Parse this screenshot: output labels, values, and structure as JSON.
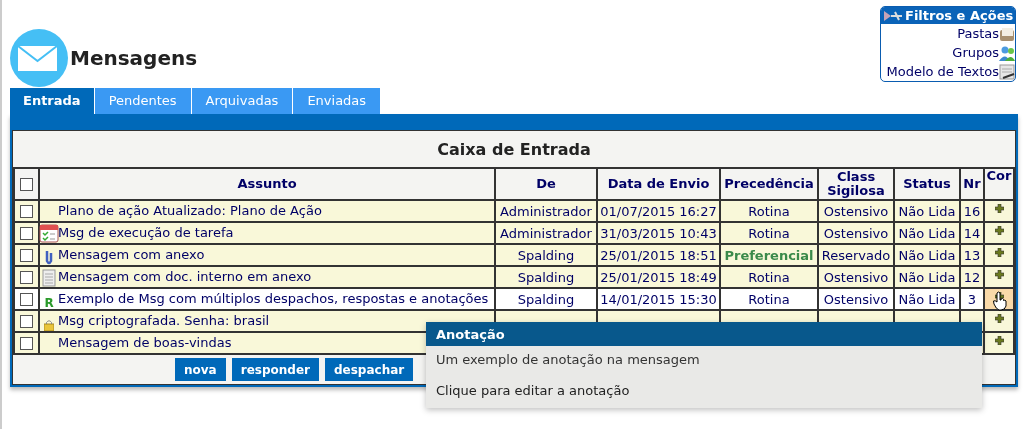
{
  "header": {
    "title": "Mensagens"
  },
  "filters": {
    "title": "Filtros e Ações",
    "links": [
      {
        "label": "Pastas",
        "kind": "folder"
      },
      {
        "label": "Grupos",
        "kind": "people"
      },
      {
        "label": "Modelo de Textos",
        "kind": "template"
      }
    ]
  },
  "tabs": [
    {
      "label": "Entrada",
      "selected": true
    },
    {
      "label": "Pendentes",
      "selected": false
    },
    {
      "label": "Arquivadas",
      "selected": false
    },
    {
      "label": "Enviadas",
      "selected": false
    }
  ],
  "inbox": {
    "title": "Caixa de Entrada",
    "select_all": {
      "checked": false
    },
    "columns": [
      "Assunto",
      "De",
      "Data de Envio",
      "Precedência",
      "Class Sigilosa",
      "Status",
      "Nr",
      "Cor"
    ],
    "rows": [
      {
        "checked": false,
        "highlighted": false,
        "kind": "plain",
        "subject": "Plano de ação Atualizado: Plano de Ação",
        "from": "Administrador",
        "date": "01/07/2015 16:27",
        "precedence": "Rotina",
        "preferential": false,
        "classification": "Ostensivo",
        "status": "Não Lida",
        "nr": "16"
      },
      {
        "checked": false,
        "highlighted": false,
        "kind": "task",
        "subject": "Msg de execução de tarefa",
        "from": "Administrador",
        "date": "31/03/2015 10:43",
        "precedence": "Rotina",
        "preferential": false,
        "classification": "Ostensivo",
        "status": "Não Lida",
        "nr": "14"
      },
      {
        "checked": false,
        "highlighted": false,
        "kind": "attachment",
        "subject": "Mensagem com anexo",
        "from": "Spalding",
        "date": "25/01/2015 18:51",
        "precedence": "Preferencial",
        "preferential": true,
        "classification": "Reservado",
        "status": "Não Lida",
        "nr": "13"
      },
      {
        "checked": false,
        "highlighted": false,
        "kind": "document",
        "subject": "Mensagem com doc. interno em anexo",
        "from": "Spalding",
        "date": "25/01/2015 18:49",
        "precedence": "Rotina",
        "preferential": false,
        "classification": "Ostensivo",
        "status": "Não Lida",
        "nr": "12"
      },
      {
        "checked": false,
        "highlighted": true,
        "kind": "reply",
        "mark": "R",
        "subject": "Exemplo de Msg com múltiplos despachos, respostas e anotações",
        "from": "Spalding",
        "date": "14/01/2015 15:30",
        "precedence": "Rotina",
        "preferential": false,
        "classification": "Ostensivo",
        "status": "Não Lida",
        "nr": "3"
      },
      {
        "checked": false,
        "highlighted": false,
        "kind": "encrypted",
        "subject": "Msg criptografada. Senha: brasil"
      },
      {
        "checked": false,
        "highlighted": false,
        "kind": "plain",
        "subject": "Mensagem de boas-vindas"
      }
    ],
    "buttons": [
      "nova",
      "responder",
      "despachar"
    ]
  },
  "tooltip": {
    "title": "Anotação",
    "text": "Um exemplo de anotação na mensagem",
    "hint": "Clique para editar a anotação"
  }
}
